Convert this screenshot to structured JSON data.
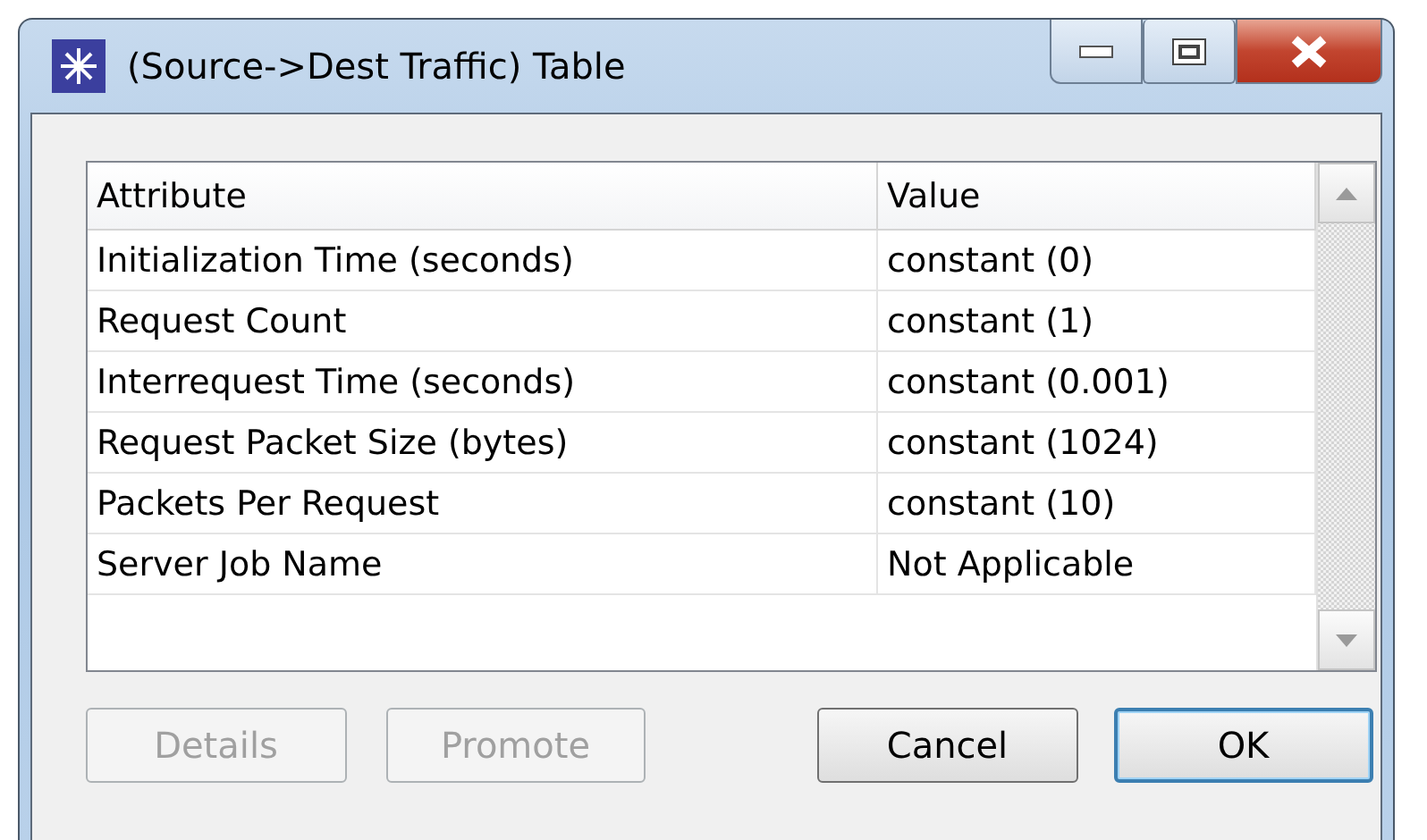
{
  "window": {
    "title": "(Source->Dest Traffic) Table"
  },
  "table": {
    "columns": [
      "Attribute",
      "Value"
    ],
    "rows": [
      {
        "attribute": "Initialization Time (seconds)",
        "value": "constant (0)"
      },
      {
        "attribute": "Request Count",
        "value": "constant (1)"
      },
      {
        "attribute": "Interrequest Time (seconds)",
        "value": "constant (0.001)"
      },
      {
        "attribute": "Request Packet Size (bytes)",
        "value": "constant (1024)"
      },
      {
        "attribute": "Packets Per Request",
        "value": "constant (10)"
      },
      {
        "attribute": "Server Job Name",
        "value": "Not Applicable"
      }
    ]
  },
  "buttons": [
    {
      "label": "Details",
      "disabled": true,
      "default": false
    },
    {
      "label": "Promote",
      "disabled": true,
      "default": false
    },
    {
      "label": "Cancel",
      "disabled": false,
      "default": false
    },
    {
      "label": "OK",
      "disabled": false,
      "default": true
    }
  ]
}
